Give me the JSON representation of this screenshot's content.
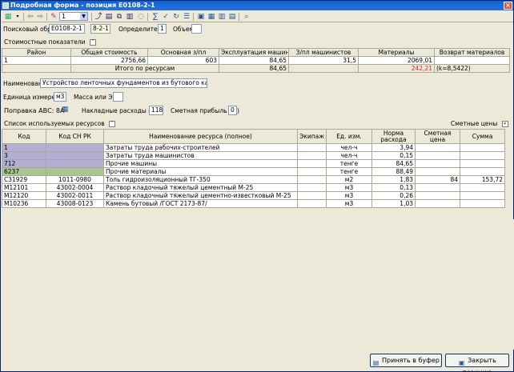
{
  "window": {
    "title": "Подробная форма - позиция E0108-2-1"
  },
  "toolbar": {
    "select_value": "1"
  },
  "header": {
    "search_label": "Поисковый образ",
    "search_value": "E0108-2-1",
    "code_value": "8-2-1",
    "determinant_label": "Определитель",
    "determinant_value": "1",
    "volume_label": "Объем",
    "volume_value": ""
  },
  "costs": {
    "title": "Стоимостные показатели",
    "columns": [
      "Район",
      "Общая стоимость",
      "Основная з/пл",
      "Эксплуатация машин",
      "З/пл машинистов",
      "Материалы",
      "Возврат материалов"
    ],
    "row": [
      "1",
      "2756,66",
      "603",
      "84,65",
      "31,5",
      "2069,01",
      ""
    ],
    "total_label": "Итого по ресурсам",
    "total_machines": "84,65",
    "total_return": "242,21",
    "total_coef": "(k=8,5422)"
  },
  "details": {
    "name_label": "Наименование",
    "name_value": "Устройство ленточных фундаментов из бутового камня",
    "unit_label": "Единица измерения",
    "unit_value": "м3",
    "mass_label": "Масса или ЭСН",
    "mass_value": "",
    "abc_label": "Поправка АВС: 8А",
    "overhead_label": "Накладные расходы (%)",
    "overhead_value": "118",
    "profit_label": "Сметная прибыль (%)",
    "profit_value": "0"
  },
  "resources": {
    "title": "Список используемых ресурсов",
    "prices_label": "Сметные цены",
    "columns": [
      "Код",
      "Код СН РК",
      "Наименование ресурса (полное)",
      "Экипаж",
      "Ед. изм.",
      "Норма расхода",
      "Сметная цена",
      "Сумма"
    ],
    "rows": [
      {
        "code": "1",
        "snrk": "",
        "name": "Затраты труда рабочих-строителей",
        "crew": "",
        "unit": "чел-ч",
        "norm": "3,94",
        "price": "",
        "sum": ""
      },
      {
        "code": "3",
        "snrk": "",
        "name": "Затраты труда машинистов",
        "crew": "",
        "unit": "чел-ч",
        "norm": "0,15",
        "price": "",
        "sum": ""
      },
      {
        "code": "712",
        "snrk": "",
        "name": "Прочие машины",
        "crew": "",
        "unit": "тенге",
        "norm": "84,65",
        "price": "",
        "sum": ""
      },
      {
        "code": "6237",
        "snrk": "",
        "name": "Прочие материалы",
        "crew": "",
        "unit": "тенге",
        "norm": "88,49",
        "price": "",
        "sum": ""
      },
      {
        "code": "С31929",
        "snrk": "1011-0980",
        "name": "Толь гидроизоляционный ТГ-350",
        "crew": "",
        "unit": "м2",
        "norm": "1,83",
        "price": "84",
        "sum": "153,72"
      },
      {
        "code": "М12101",
        "snrk": "43002-0004",
        "name": "Раствор кладочный тяжелый цементный М-25",
        "crew": "",
        "unit": "м3",
        "norm": "0,13",
        "price": "",
        "sum": ""
      },
      {
        "code": "М12120",
        "snrk": "43002-0011",
        "name": "Раствор кладочный тяжелый цементно-известковый М-25",
        "crew": "",
        "unit": "м3",
        "norm": "0,26",
        "price": "",
        "sum": ""
      },
      {
        "code": "М10236",
        "snrk": "43008-0123",
        "name": "Камень бутовый /ГОСТ 2173-87/",
        "crew": "",
        "unit": "м3",
        "norm": "1,03",
        "price": "",
        "sum": ""
      }
    ]
  },
  "buttons": {
    "accept": "Принять в буфер",
    "close": "Закрыть позицию"
  }
}
